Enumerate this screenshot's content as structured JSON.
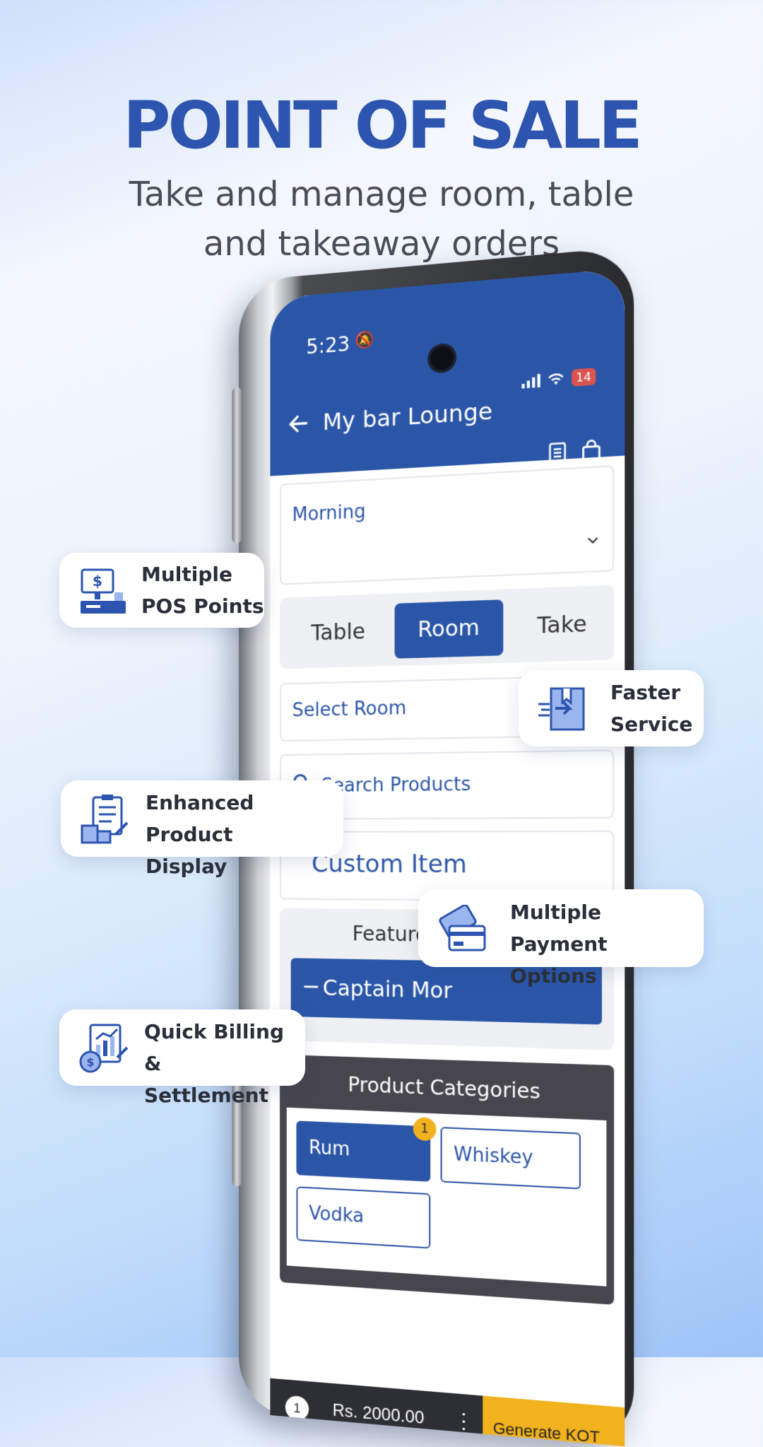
{
  "hero": {
    "title": "POINT OF SALE",
    "subtitle": "Take and manage room, table and takeaway orders"
  },
  "status_bar": {
    "time": "5:23",
    "battery": "14"
  },
  "app": {
    "title": "My bar Lounge",
    "shift_select_value": "Morning",
    "order_tabs": [
      "Table",
      "Room",
      "Take Away"
    ],
    "active_tab": "Room",
    "room_select_placeholder": "Select Room",
    "search_placeholder": "Search Products",
    "custom_item_label": "Custom Item",
    "featured_title": "Featured Products",
    "featured_item": "Captain Mor",
    "categories_title": "Product Categories",
    "categories": [
      {
        "label": "Rum",
        "badge": "1",
        "active": true
      },
      {
        "label": "Whiskey",
        "active": false
      },
      {
        "label": "Vodka",
        "active": false
      }
    ],
    "cart_count": "1",
    "cart_total": "Rs. 2000.00",
    "generate_kot_label": "Generate KOT"
  },
  "features": [
    {
      "line1": "Multiple",
      "line2": "POS Points",
      "icon": "pos-terminal-icon"
    },
    {
      "line1": "Faster",
      "line2": "Service",
      "icon": "fast-delivery-box-icon"
    },
    {
      "line1": "Enhanced Product",
      "line2": "Display",
      "icon": "product-clipboard-icon"
    },
    {
      "line1": "Multiple Payment",
      "line2": "Options",
      "icon": "payment-cards-icon"
    },
    {
      "line1": "Quick Billing &",
      "line2": "Settlement",
      "icon": "billing-chart-icon"
    }
  ],
  "colors": {
    "brand_blue": "#2b56a8",
    "title_blue": "#2d55b0",
    "accent_yellow": "#f2b21e",
    "dark_panel": "#47464e"
  }
}
